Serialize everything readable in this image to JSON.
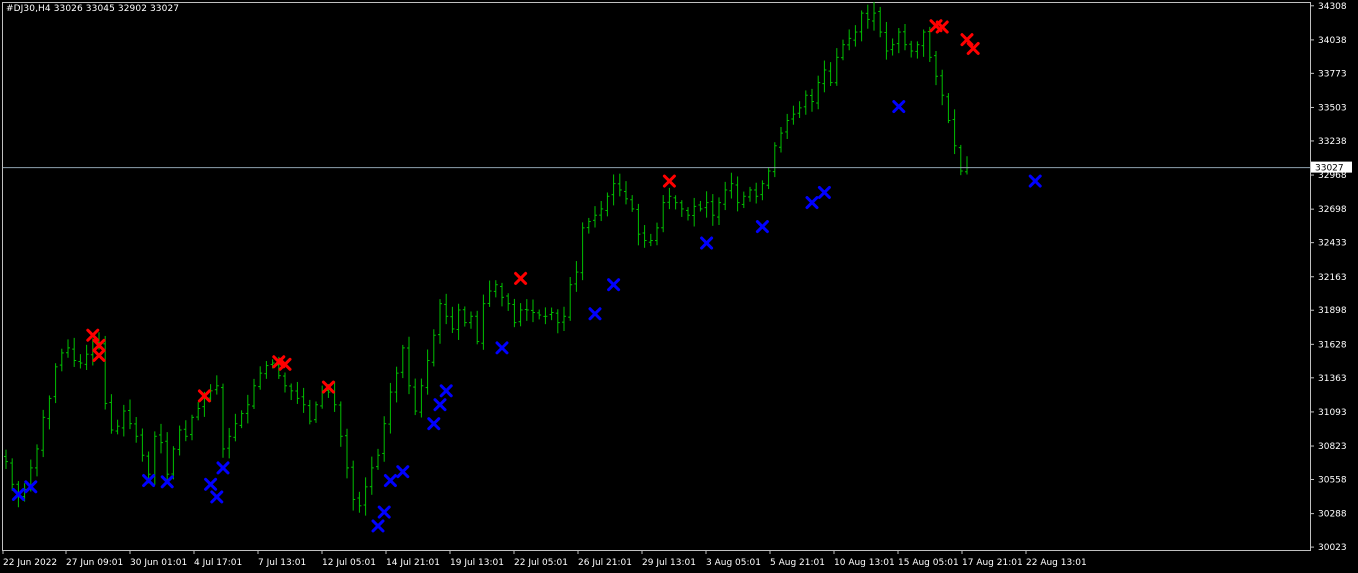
{
  "chart": {
    "symbol_timeframe": "#DJ30,H4",
    "ohlc_summary": "33026 33045 32902 33027",
    "current_price_label": "33027",
    "colors": {
      "background": "#000000",
      "bars": "#00c000",
      "axis": "#c0c0c0",
      "price_line": "#8fa3b0",
      "sell_marker": "#ff0000",
      "buy_marker": "#0000ff",
      "text": "#ffffff"
    }
  },
  "chart_data": {
    "type": "ohlc",
    "y_ticks": [
      34308,
      34038,
      33773,
      33503,
      33238,
      32968,
      32698,
      32433,
      32163,
      31898,
      31628,
      31363,
      31093,
      30823,
      30558,
      30288,
      30023
    ],
    "ylim": [
      30000,
      34330
    ],
    "current_price": 33027,
    "x_ticks": [
      "22 Jun 2022",
      "27 Jun 09:01",
      "30 Jun 01:01",
      "4 Jul 17:01",
      "7 Jul 13:01",
      "12 Jul 05:01",
      "14 Jul 21:01",
      "19 Jul 13:01",
      "22 Jul 05:01",
      "26 Jul 21:01",
      "29 Jul 13:01",
      "3 Aug 05:01",
      "5 Aug 21:01",
      "10 Aug 13:01",
      "15 Aug 05:01",
      "17 Aug 21:01",
      "22 Aug 13:01"
    ],
    "close_path": [
      30700,
      30520,
      30420,
      30480,
      30650,
      30800,
      31050,
      31200,
      31450,
      31560,
      31600,
      31500,
      31480,
      31550,
      31650,
      31640,
      31160,
      30950,
      30980,
      31100,
      31000,
      30900,
      30750,
      30600,
      30900,
      30850,
      30600,
      30800,
      30950,
      30900,
      31050,
      31120,
      31200,
      31260,
      31300,
      30800,
      30900,
      31000,
      31080,
      31150,
      31300,
      31400,
      31460,
      31480,
      31380,
      31300,
      31260,
      31200,
      31150,
      31020,
      31150,
      31260,
      31250,
      31150,
      30900,
      30650,
      30400,
      30350,
      30500,
      30650,
      30750,
      31000,
      31250,
      31400,
      31600,
      31300,
      31100,
      31300,
      31500,
      31700,
      31950,
      31850,
      31750,
      31900,
      31800,
      31850,
      31650,
      31950,
      32050,
      32100,
      32000,
      31950,
      31800,
      31900,
      31900,
      31880,
      31860,
      31850,
      31880,
      31800,
      31850,
      32100,
      32200,
      32550,
      32600,
      32650,
      32700,
      32800,
      32900,
      32850,
      32780,
      32700,
      32500,
      32450,
      32450,
      32550,
      32750,
      32800,
      32750,
      32700,
      32650,
      32720,
      32700,
      32750,
      32650,
      32750,
      32850,
      32900,
      32750,
      32800,
      32850,
      32800,
      32900,
      33000,
      33200,
      33300,
      33400,
      33450,
      33500,
      33600,
      33550,
      33700,
      33800,
      33700,
      33900,
      34000,
      34050,
      34100,
      34250,
      34200,
      34250,
      34100,
      33950,
      34000,
      34100,
      34000,
      33950,
      34000,
      34100,
      33900,
      33750,
      33600,
      33400,
      33200,
      33000,
      33027
    ],
    "sell_markers": [
      {
        "bar": 14,
        "price": 31700
      },
      {
        "bar": 15,
        "price": 31620
      },
      {
        "bar": 15,
        "price": 31540
      },
      {
        "bar": 32,
        "price": 31220
      },
      {
        "bar": 44,
        "price": 31490
      },
      {
        "bar": 45,
        "price": 31470
      },
      {
        "bar": 52,
        "price": 31290
      },
      {
        "bar": 83,
        "price": 32150
      },
      {
        "bar": 107,
        "price": 32920
      },
      {
        "bar": 150,
        "price": 34150
      },
      {
        "bar": 151,
        "price": 34140
      },
      {
        "bar": 155,
        "price": 34040
      },
      {
        "bar": 156,
        "price": 33970
      }
    ],
    "buy_markers": [
      {
        "bar": 2,
        "price": 30440
      },
      {
        "bar": 4,
        "price": 30500
      },
      {
        "bar": 23,
        "price": 30550
      },
      {
        "bar": 26,
        "price": 30540
      },
      {
        "bar": 33,
        "price": 30520
      },
      {
        "bar": 34,
        "price": 30420
      },
      {
        "bar": 35,
        "price": 30650
      },
      {
        "bar": 60,
        "price": 30190
      },
      {
        "bar": 61,
        "price": 30300
      },
      {
        "bar": 62,
        "price": 30550
      },
      {
        "bar": 64,
        "price": 30620
      },
      {
        "bar": 69,
        "price": 31000
      },
      {
        "bar": 70,
        "price": 31150
      },
      {
        "bar": 71,
        "price": 31260
      },
      {
        "bar": 80,
        "price": 31600
      },
      {
        "bar": 95,
        "price": 31870
      },
      {
        "bar": 98,
        "price": 32100
      },
      {
        "bar": 113,
        "price": 32430
      },
      {
        "bar": 122,
        "price": 32560
      },
      {
        "bar": 130,
        "price": 32750
      },
      {
        "bar": 132,
        "price": 32830
      },
      {
        "bar": 144,
        "price": 33510
      },
      {
        "bar": 166,
        "price": 32920
      }
    ]
  }
}
